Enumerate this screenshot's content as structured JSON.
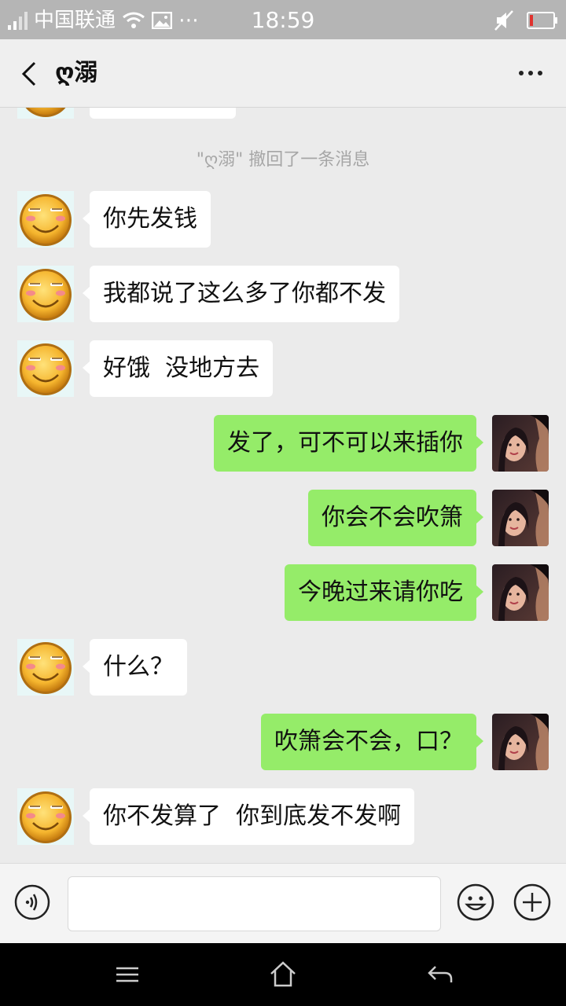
{
  "status_bar": {
    "carrier": "中国联通",
    "extra": "⋯",
    "time": "18:59",
    "battery_level": 0.15,
    "battery_color": "#e0332e"
  },
  "header": {
    "title": "ღ溺"
  },
  "messages": [
    {
      "side": "in",
      "text": ""
    },
    {
      "side": "system",
      "text": "\"ღ溺\" 撤回了一条消息"
    },
    {
      "side": "in",
      "text": "你先发钱"
    },
    {
      "side": "in",
      "text": "我都说了这么多了你都不发"
    },
    {
      "side": "in",
      "text": "好饿  没地方去"
    },
    {
      "side": "out",
      "text": "发了，可不可以来插你"
    },
    {
      "side": "out",
      "text": "你会不会吹箫"
    },
    {
      "side": "out",
      "text": "今晚过来请你吃"
    },
    {
      "side": "in",
      "text": "什么？"
    },
    {
      "side": "out",
      "text": "吹箫会不会，口？"
    },
    {
      "side": "in",
      "text": "你不发算了  你到底发不发啊"
    }
  ],
  "input": {
    "value": ""
  },
  "colors": {
    "outgoing_bubble": "#95ec69",
    "incoming_bubble": "#ffffff",
    "chat_background": "#ebebeb"
  }
}
